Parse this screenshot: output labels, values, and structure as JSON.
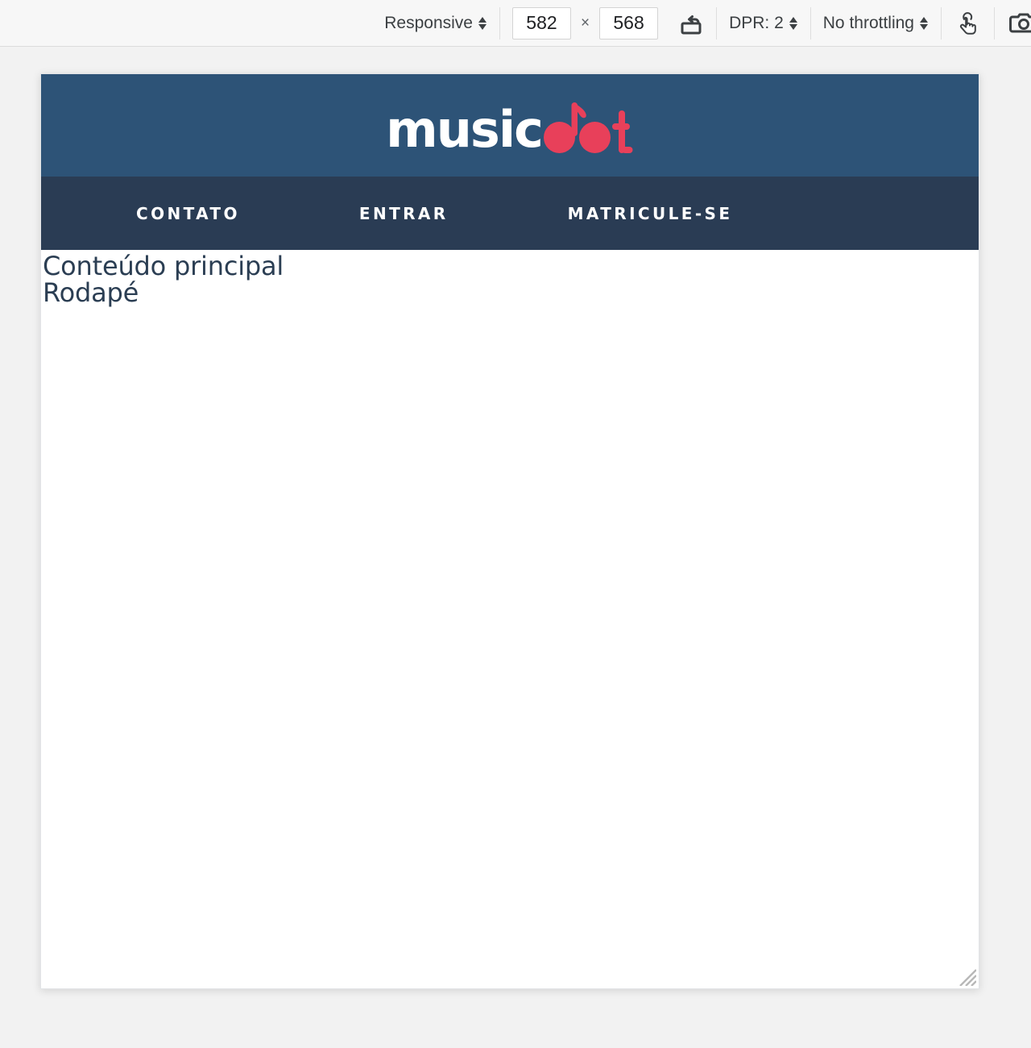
{
  "devtools_toolbar": {
    "device_preset": {
      "label": "Responsive",
      "icon": "chevron-updown-icon"
    },
    "dimensions": {
      "width_value": "582",
      "width_placeholder": "width",
      "separator": "×",
      "height_value": "568",
      "height_placeholder": "height"
    },
    "rotate": {
      "icon": "rotate-device-icon",
      "tooltip": "Rotate"
    },
    "dpr": {
      "label": "DPR: 2",
      "icon": "chevron-updown-icon"
    },
    "throttling": {
      "label": "No throttling",
      "icon": "chevron-updown-icon"
    },
    "touch": {
      "icon": "touch-hand-icon",
      "tooltip": "Touch simulation"
    },
    "screenshot": {
      "icon": "camera-icon",
      "tooltip": "Capture screenshot"
    }
  },
  "page": {
    "header": {
      "logo": {
        "text_primary": "music",
        "text_accent": "dot",
        "mark_icon": "music-note-icon"
      },
      "background_color": "#2d5377"
    },
    "nav": {
      "background_color": "#2a3c54",
      "items": [
        {
          "label": "CONTATO"
        },
        {
          "label": "ENTRAR"
        },
        {
          "label": "MATRICULE-SE"
        }
      ]
    },
    "main": {
      "lines": [
        "Conteúdo principal",
        "Rodapé"
      ],
      "text_color": "#2b3e53",
      "background_color": "#ffffff"
    }
  },
  "colors": {
    "brand_blue": "#2d5377",
    "brand_navy": "#2a3c54",
    "brand_red": "#e8405a",
    "toolbar_bg": "#f7f7f7",
    "page_bg": "#f2f2f2"
  }
}
